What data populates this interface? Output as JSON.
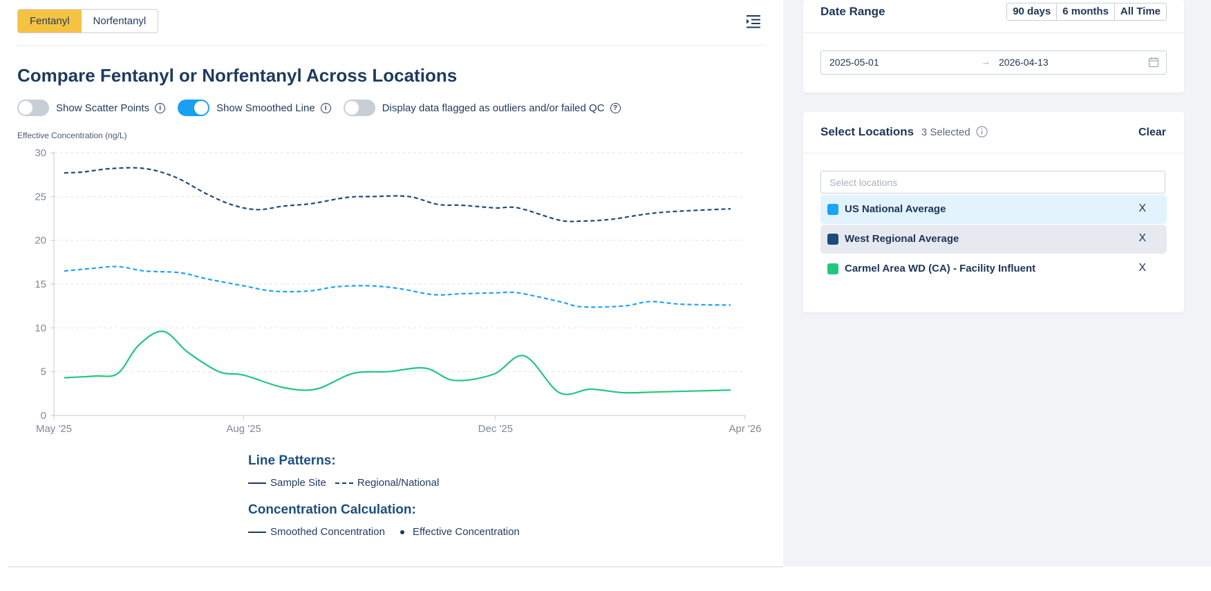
{
  "tabs": [
    "Fentanyl",
    "Norfentanyl"
  ],
  "active_tab": "Fentanyl",
  "title": "Compare Fentanyl or Norfentanyl Across Locations",
  "toggles": {
    "scatter_label": "Show Scatter Points",
    "scatter_on": false,
    "smoothed_label": "Show Smoothed Line",
    "smoothed_on": true,
    "outliers_label": "Display data flagged as outliers and/or failed QC",
    "outliers_on": false
  },
  "legend": {
    "line_patterns_title": "Line Patterns:",
    "sample_site": "Sample Site",
    "regional_national": "Regional/National",
    "calc_title": "Concentration Calculation:",
    "smoothed": "Smoothed Concentration",
    "effective": "Effective Concentration"
  },
  "date_range": {
    "title": "Date Range",
    "buttons": [
      "90 days",
      "6 months",
      "All Time"
    ],
    "start": "2025-05-01",
    "end": "2026-04-13",
    "arrow": "→"
  },
  "locations": {
    "title": "Select Locations",
    "count": "3 Selected",
    "clear": "Clear",
    "placeholder": "Select locations",
    "remove_symbol": "X",
    "items": [
      {
        "name": "US National Average",
        "color": "#1aa3ff",
        "highlight": "#e2f3fd"
      },
      {
        "name": "West Regional Average",
        "color": "#1e4b79",
        "highlight": "#e6eaf0"
      },
      {
        "name": "Carmel Area WD (CA) - Facility Influent",
        "color": "#22c77f",
        "highlight": ""
      }
    ]
  },
  "chart_data": {
    "type": "line",
    "ylabel": "Effective Concentration (ng/L)",
    "ylim": [
      0,
      30
    ],
    "yticks": [
      0,
      5,
      10,
      15,
      20,
      25,
      30
    ],
    "x_ticks": [
      {
        "date": "2025-05-01",
        "label": "May '25"
      },
      {
        "date": "2025-08-01",
        "label": "Aug '25"
      },
      {
        "date": "2025-12-01",
        "label": "Dec '25"
      },
      {
        "date": "2026-04-01",
        "label": "Apr '26"
      }
    ],
    "xlim": [
      "2025-05-01",
      "2026-04-01"
    ],
    "grid": true,
    "series": [
      {
        "name": "West Regional Average",
        "color": "#1e4b79",
        "dash": true,
        "x": [
          "2025-05-06",
          "2025-05-15",
          "2025-05-29",
          "2025-06-14",
          "2025-06-29",
          "2025-07-14",
          "2025-07-27",
          "2025-08-08",
          "2025-08-20",
          "2025-09-03",
          "2025-09-20",
          "2025-10-03",
          "2025-10-20",
          "2025-11-03",
          "2025-11-15",
          "2025-12-01",
          "2025-12-12",
          "2026-01-01",
          "2026-01-12",
          "2026-01-26",
          "2026-02-12",
          "2026-02-26",
          "2026-03-25"
        ],
        "y": [
          27.7,
          27.8,
          28.2,
          28.2,
          27.2,
          25.3,
          24.0,
          23.5,
          23.9,
          24.2,
          24.9,
          25.0,
          25.0,
          24.1,
          24.0,
          23.7,
          23.7,
          22.3,
          22.2,
          22.4,
          23.0,
          23.3,
          23.6
        ]
      },
      {
        "name": "US National Average",
        "color": "#1aa3ff",
        "dash": true,
        "x": [
          "2025-05-06",
          "2025-05-20",
          "2025-06-01",
          "2025-06-14",
          "2025-07-01",
          "2025-07-14",
          "2025-08-01",
          "2025-08-15",
          "2025-09-01",
          "2025-09-15",
          "2025-10-01",
          "2025-10-15",
          "2025-11-01",
          "2025-11-15",
          "2025-12-01",
          "2025-12-12",
          "2026-01-01",
          "2026-01-12",
          "2026-02-01",
          "2026-02-14",
          "2026-03-01",
          "2026-03-25"
        ],
        "y": [
          16.5,
          16.8,
          17.0,
          16.5,
          16.3,
          15.6,
          14.8,
          14.2,
          14.2,
          14.7,
          14.8,
          14.5,
          13.8,
          13.9,
          14.0,
          14.0,
          13.0,
          12.4,
          12.5,
          13.0,
          12.7,
          12.6
        ]
      },
      {
        "name": "Carmel Area WD (CA) - Facility Influent",
        "color": "#22c77f",
        "dash": false,
        "x": [
          "2025-05-06",
          "2025-05-21",
          "2025-06-01",
          "2025-06-11",
          "2025-06-23",
          "2025-07-05",
          "2025-07-20",
          "2025-08-01",
          "2025-08-20",
          "2025-09-05",
          "2025-09-23",
          "2025-10-10",
          "2025-10-28",
          "2025-11-11",
          "2025-11-30",
          "2025-12-15",
          "2026-01-01",
          "2026-01-16",
          "2026-02-01",
          "2026-02-20",
          "2026-03-25"
        ],
        "y": [
          4.3,
          4.5,
          4.8,
          8.0,
          9.6,
          7.2,
          5.0,
          4.6,
          3.2,
          3.0,
          4.8,
          5.0,
          5.4,
          4.0,
          4.7,
          6.8,
          2.6,
          3.0,
          2.6,
          2.7,
          2.9
        ]
      }
    ]
  }
}
